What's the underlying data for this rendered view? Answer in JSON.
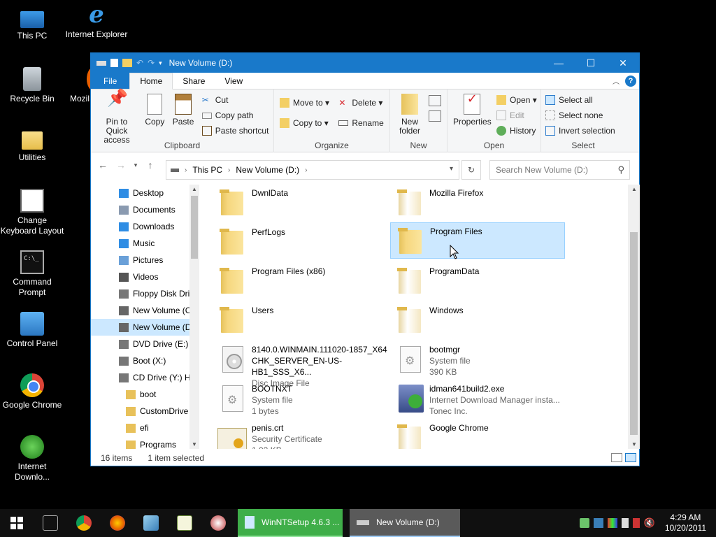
{
  "desktop": {
    "icons": [
      {
        "label": "This PC"
      },
      {
        "label": "Internet Explorer"
      },
      {
        "label": "Recycle Bin"
      },
      {
        "label": "Mozil"
      },
      {
        "label": "Utilities"
      },
      {
        "label": "Change Keyboard Layout"
      },
      {
        "label": "Command Prompt"
      },
      {
        "label": "Control Panel"
      },
      {
        "label": "Google Chrome"
      },
      {
        "label": "Internet Downlo..."
      }
    ],
    "ie_glyph": "e",
    "cmd_glyph": "C:\\_"
  },
  "window": {
    "title": "New Volume (D:)",
    "controls": {
      "minimize": "—",
      "maximize": "☐",
      "close": "✕"
    },
    "tabs": {
      "file": "File",
      "home": "Home",
      "share": "Share",
      "view": "View"
    },
    "help": "?",
    "ribbon": {
      "clipboard": {
        "label": "Clipboard",
        "pin": "Pin to Quick access",
        "copy": "Copy",
        "paste": "Paste",
        "cut": "Cut",
        "copy_path": "Copy path",
        "paste_shortcut": "Paste shortcut"
      },
      "organize": {
        "label": "Organize",
        "move_to": "Move to ▾",
        "copy_to": "Copy to ▾",
        "delete": "Delete ▾",
        "rename": "Rename"
      },
      "new": {
        "label": "New",
        "new_folder": "New folder"
      },
      "open": {
        "label": "Open",
        "properties": "Properties",
        "open": "Open ▾",
        "edit": "Edit",
        "history": "History"
      },
      "select": {
        "label": "Select",
        "select_all": "Select all",
        "select_none": "Select none",
        "invert": "Invert selection"
      }
    },
    "address": {
      "crumbs": [
        "This PC",
        "New Volume (D:)"
      ],
      "search_placeholder": "Search New Volume (D:)"
    },
    "nav": [
      {
        "label": "Desktop",
        "color": "#2f8de4"
      },
      {
        "label": "Documents",
        "color": "#8a9ab0"
      },
      {
        "label": "Downloads",
        "color": "#2f8de4"
      },
      {
        "label": "Music",
        "color": "#2f8de4"
      },
      {
        "label": "Pictures",
        "color": "#6aa0d8"
      },
      {
        "label": "Videos",
        "color": "#555"
      },
      {
        "label": "Floppy Disk Dri",
        "color": "#777"
      },
      {
        "label": "New Volume (C",
        "color": "#666"
      },
      {
        "label": "New Volume (D",
        "color": "#666"
      },
      {
        "label": "DVD Drive (E:) I",
        "color": "#777"
      },
      {
        "label": "Boot (X:)",
        "color": "#777"
      },
      {
        "label": "CD Drive (Y:) H",
        "color": "#777"
      },
      {
        "label": "boot",
        "color": "#e8c15a"
      },
      {
        "label": "CustomDrive",
        "color": "#e8c15a"
      },
      {
        "label": "efi",
        "color": "#e8c15a"
      },
      {
        "label": "Programs",
        "color": "#e8c15a"
      }
    ],
    "files": [
      {
        "name": "DwnlData",
        "l2": "",
        "l3": ""
      },
      {
        "name": "Mozilla Firefox",
        "l2": "",
        "l3": ""
      },
      {
        "name": "PerfLogs",
        "l2": "",
        "l3": ""
      },
      {
        "name": "Program Files",
        "l2": "",
        "l3": ""
      },
      {
        "name": "Program Files (x86)",
        "l2": "",
        "l3": ""
      },
      {
        "name": "ProgramData",
        "l2": "",
        "l3": ""
      },
      {
        "name": "Users",
        "l2": "",
        "l3": ""
      },
      {
        "name": "Windows",
        "l2": "",
        "l3": ""
      },
      {
        "name": "8140.0.WINMAIN.111020-1857_X64",
        "l2": "CHK_SERVER_EN-US-HB1_SSS_X6...",
        "l3": "Disc Image File"
      },
      {
        "name": "bootmgr",
        "l2": "System file",
        "l3": "390 KB"
      },
      {
        "name": "BOOTNXT",
        "l2": "System file",
        "l3": "1 bytes"
      },
      {
        "name": "idman641build2.exe",
        "l2": "Internet Download Manager insta...",
        "l3": "Tonec Inc."
      },
      {
        "name": "penis.crt",
        "l2": "Security Certificate",
        "l3": "1.02 KB"
      },
      {
        "name": "Google Chrome",
        "l2": "",
        "l3": ""
      }
    ],
    "status": {
      "count": "16 items",
      "selected": "1 item selected"
    }
  },
  "taskbar": {
    "apps": [
      {
        "label": "WinNTSetup 4.6.3  ..."
      },
      {
        "label": "New Volume (D:)"
      }
    ],
    "clock": {
      "time": "4:29 AM",
      "date": "10/20/2011"
    }
  }
}
